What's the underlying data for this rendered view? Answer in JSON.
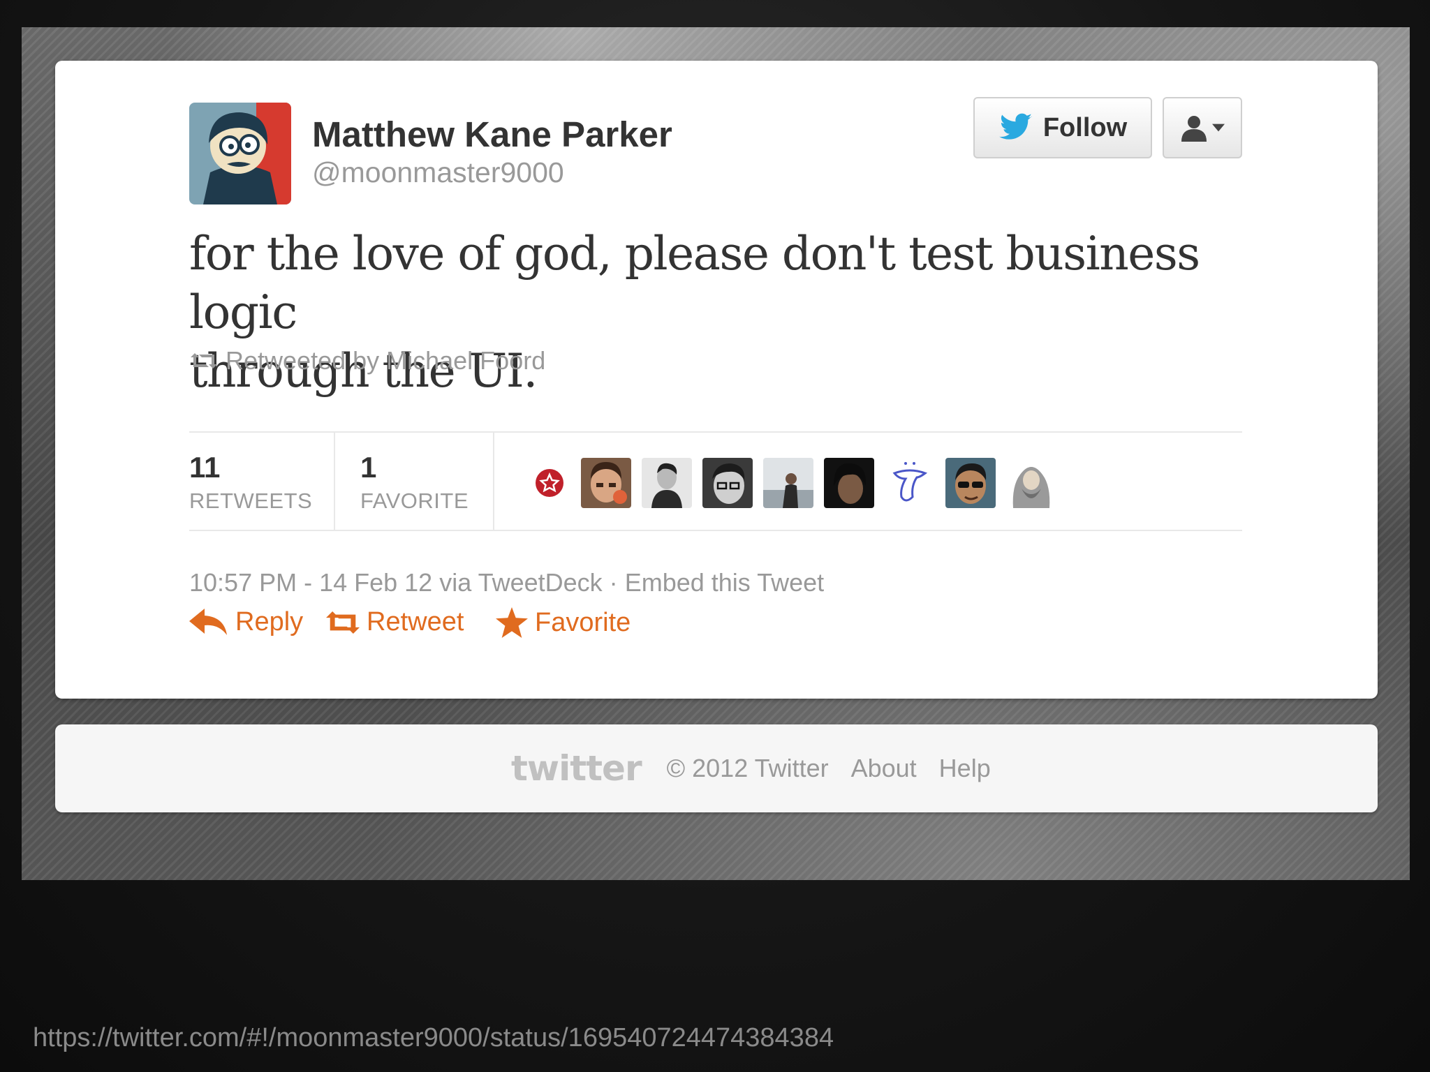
{
  "author": {
    "name": "Matthew Kane Parker",
    "handle": "@moonmaster9000"
  },
  "header": {
    "follow_label": "Follow"
  },
  "tweet": {
    "line1": "for the love of god, please don't test business logic",
    "line2": "through the UI.",
    "retweeted_by": "Retweeted by Michael Foord"
  },
  "stats": {
    "retweets_count": "11",
    "retweets_label": "RETWEETS",
    "favorites_count": "1",
    "favorites_label": "FAVORITE",
    "avatars": [
      "badge-icon",
      "face-1",
      "face-2",
      "face-3",
      "face-4",
      "face-5",
      "sketch-icon",
      "face-6",
      "face-7"
    ]
  },
  "meta": {
    "timestamp": "10:57 PM - 14 Feb 12 via TweetDeck",
    "separator": "·",
    "embed": "Embed this Tweet"
  },
  "actions": {
    "reply": "Reply",
    "retweet": "Retweet",
    "favorite": "Favorite"
  },
  "footer": {
    "logo": "twitter",
    "copyright": "© 2012 Twitter",
    "about": "About",
    "help": "Help"
  },
  "slide": {
    "url": "https://twitter.com/#!/moonmaster9000/status/169540724474384384"
  },
  "colors": {
    "accent": "#e06b1f",
    "twitter_blue": "#2aa9e0",
    "text": "#333333",
    "muted": "#999999"
  }
}
